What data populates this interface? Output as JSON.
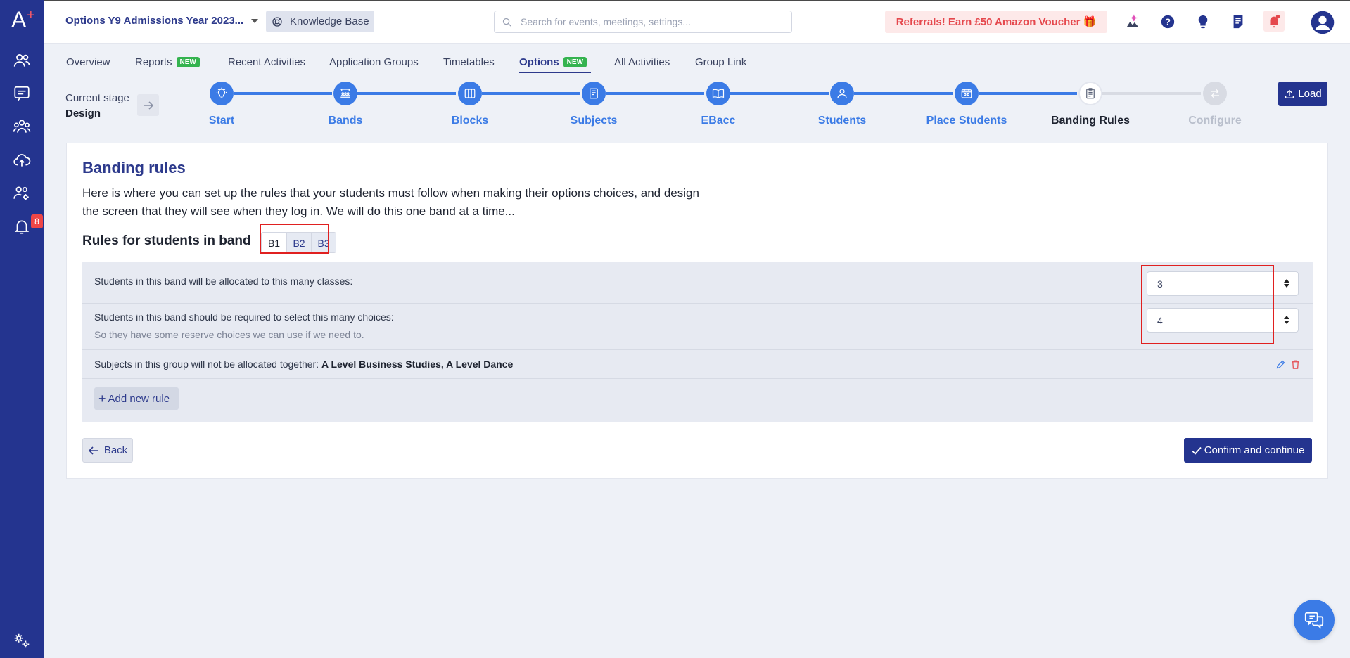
{
  "app": {
    "logo": "A",
    "title": "Options Y9 Admissions Year 2023...",
    "knowledge_base": "Knowledge Base",
    "search_placeholder": "Search for events, meetings, settings...",
    "referral": "Referrals! Earn £50 Amazon Voucher 🎁"
  },
  "sidebar": {
    "notification_count": "8",
    "items": [
      "users-icon",
      "chat-icon",
      "group-icon",
      "upload-cloud-icon",
      "users-settings-icon",
      "bell-icon"
    ],
    "footer": "settings-gears-icon"
  },
  "topbar_icons": [
    "launch-icon",
    "help-icon",
    "lightbulb-icon",
    "notes-icon",
    "notification-bell-icon",
    "profile-avatar-icon"
  ],
  "tabs": [
    {
      "label": "Overview"
    },
    {
      "label": "Reports",
      "badge": "NEW"
    },
    {
      "label": "Recent Activities"
    },
    {
      "label": "Application Groups"
    },
    {
      "label": "Timetables"
    },
    {
      "label": "Options",
      "badge": "NEW",
      "active": true
    },
    {
      "label": "All Activities"
    },
    {
      "label": "Group Link"
    }
  ],
  "stage": {
    "label": "Current stage",
    "value": "Design"
  },
  "steps": [
    {
      "label": "Start",
      "state": "done"
    },
    {
      "label": "Bands",
      "state": "done"
    },
    {
      "label": "Blocks",
      "state": "done"
    },
    {
      "label": "Subjects",
      "state": "done"
    },
    {
      "label": "EBacc",
      "state": "done"
    },
    {
      "label": "Students",
      "state": "done"
    },
    {
      "label": "Place Students",
      "state": "done"
    },
    {
      "label": "Banding Rules",
      "state": "current"
    },
    {
      "label": "Configure",
      "state": "disabled"
    }
  ],
  "load_button": "Load",
  "card": {
    "title": "Banding rules",
    "description": "Here is where you can set up the rules that your students must follow when making their options choices, and design the screen that they will see when they log in. We will do this one band at a time...",
    "rules_heading": "Rules for students in band",
    "bands": [
      "B1",
      "B2",
      "B3"
    ],
    "rule_classes": "Students in this band will be allocated to this many classes:",
    "rule_classes_value": "3",
    "rule_choices": "Students in this band should be required to select this many choices:",
    "rule_choices_sub": "So they have some reserve choices we can use if we need to.",
    "rule_choices_value": "4",
    "rule_subjects_prefix": "Subjects in this group will not be allocated together: ",
    "rule_subjects_value": "A Level Business Studies, A Level Dance",
    "add_rule": "Add new rule",
    "back": "Back",
    "confirm": "Confirm and continue"
  },
  "colors": {
    "sidebar": "#24348f",
    "accent_blue": "#3b7be6",
    "title_navy": "#2d3a8c",
    "new_badge": "#34b34f",
    "highlight_red": "#e02020"
  }
}
